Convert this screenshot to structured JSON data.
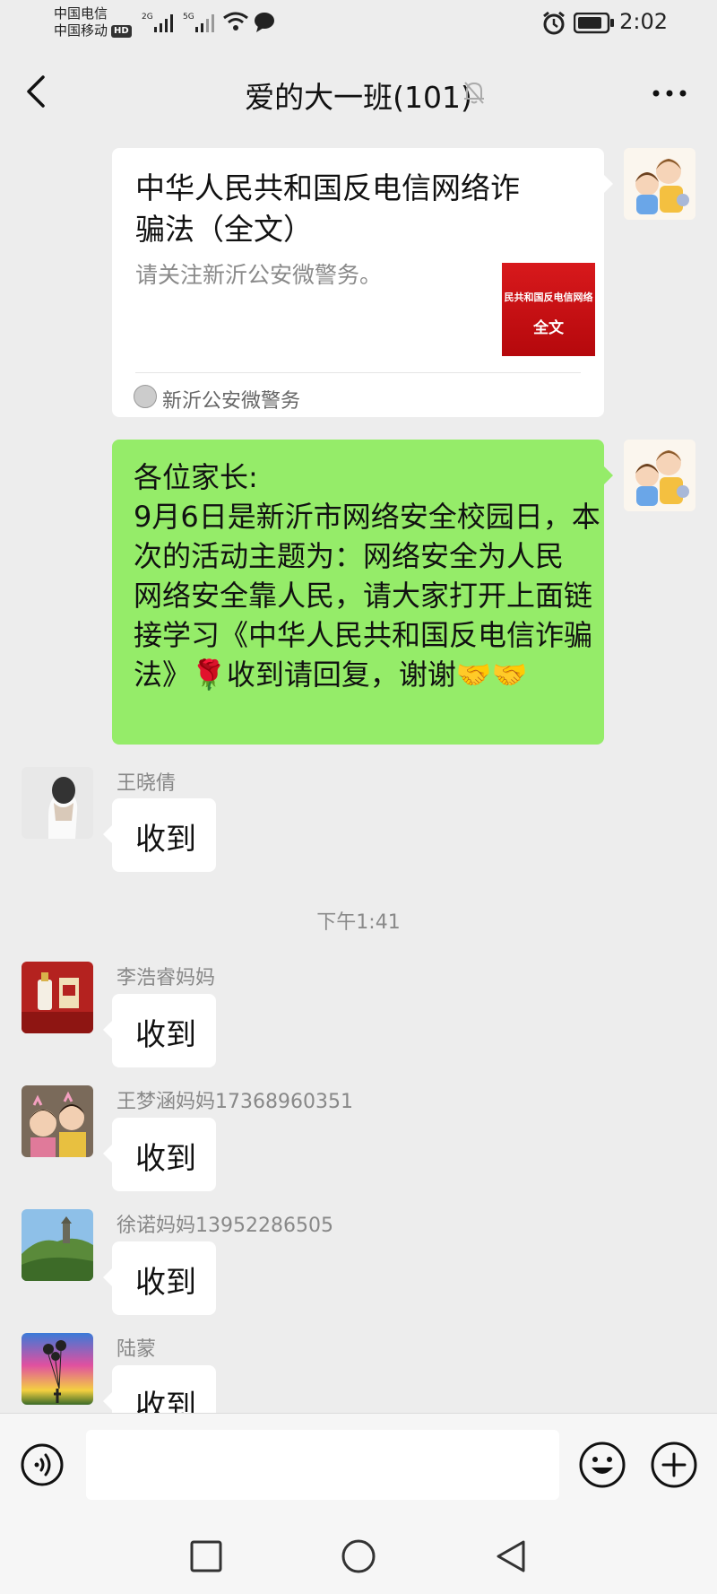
{
  "status_bar": {
    "carrier1": "中国电信",
    "carrier2": "中国移动",
    "hd_badge": "HD",
    "net1": "2G",
    "net2": "5G",
    "time": "2:02"
  },
  "header": {
    "title": "爱的大一班(101)"
  },
  "messages": {
    "link_card": {
      "title": "中华人民共和国反电信网络诈骗法（全文）",
      "description": "请关注新沂公安微警务。",
      "thumb_line1": "民共和国反电信网络",
      "thumb_line2": "全文",
      "source": "新沂公安微警务"
    },
    "green": {
      "text": "各位家长:\n9月6日是新沂市网络安全校园日，本次的活动主题为：网络安全为人民  网络安全靠人民，请大家打开上面链接学习《中华人民共和国反电信诈骗法》🌹收到请回复，谢谢🤝🤝"
    },
    "timestamp": "下午1:41",
    "received": [
      {
        "name": "王晓倩",
        "text": "收到"
      },
      {
        "name": "李浩睿妈妈",
        "text": "收到"
      },
      {
        "name": "王梦涵妈妈17368960351",
        "text": "收到"
      },
      {
        "name": "徐诺妈妈13952286505",
        "text": "收到"
      },
      {
        "name": "陆蒙",
        "text": "收到"
      }
    ]
  },
  "icons": {
    "back": "back-arrow-icon",
    "mute": "bell-muted-icon",
    "more": "more-icon",
    "voice": "voice-icon",
    "emoji": "emoji-icon",
    "plus": "plus-icon"
  },
  "colors": {
    "background": "#ededed",
    "green_bubble": "#95ec69",
    "white_bubble": "#ffffff",
    "card_thumb": "#d8191c"
  }
}
